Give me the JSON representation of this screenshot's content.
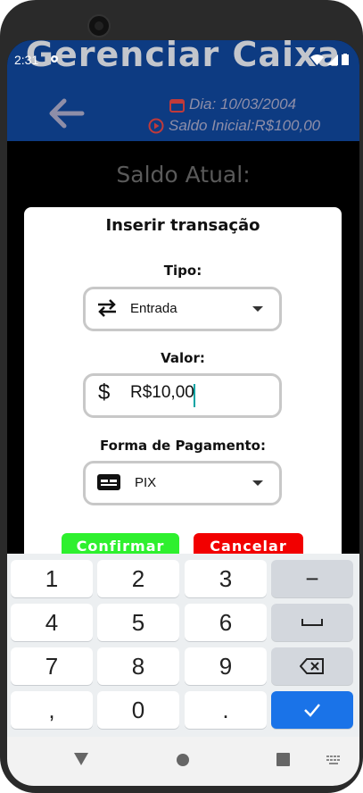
{
  "status": {
    "time": "2:31"
  },
  "app": {
    "title": "Gerenciar Caixa",
    "date_text": "Dia: 10/03/2004",
    "saldo_inicial": "Saldo Inicial:R$100,00",
    "saldo_atual_label": "Saldo Atual:"
  },
  "dialog": {
    "title": "Inserir transação",
    "tipo_label": "Tipo:",
    "tipo_value": "Entrada",
    "valor_label": "Valor:",
    "valor_value": "R$10,00",
    "forma_label": "Forma de Pagamento:",
    "forma_value": "PIX",
    "confirm": "Confirmar",
    "cancel": "Cancelar"
  },
  "keyboard": {
    "rows": [
      [
        "1",
        "2",
        "3",
        "−"
      ],
      [
        "4",
        "5",
        "6",
        "␣"
      ],
      [
        "7",
        "8",
        "9",
        "⌫"
      ],
      [
        ",",
        "0",
        ".",
        "✓"
      ]
    ]
  },
  "colors": {
    "appbar": "#0d3b82",
    "confirm": "#2ef02e",
    "cancel": "#f20000",
    "accent": "#1a73e8"
  }
}
